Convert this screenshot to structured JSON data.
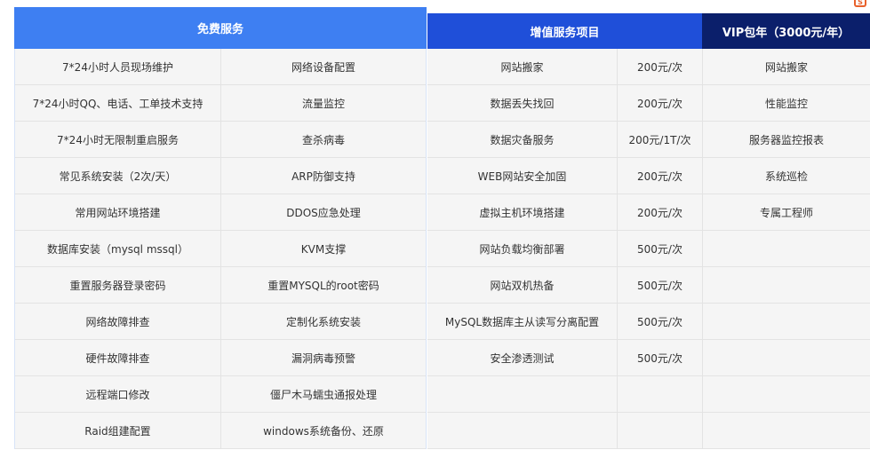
{
  "corner_icon": "logo-badge-icon",
  "colors": {
    "free_header": "#3e7ff2",
    "paid_header": "#1f4fd9",
    "vip_header": "#0b1f6b",
    "cell_bg": "#f5f5f5"
  },
  "free": {
    "title": "免费服务",
    "rows": [
      [
        "7*24小时人员现场维护",
        "网络设备配置"
      ],
      [
        "7*24小时QQ、电话、工单技术支持",
        "流量监控"
      ],
      [
        "7*24小时无限制重启服务",
        "查杀病毒"
      ],
      [
        "常见系统安装（2次/天）",
        "ARP防御支持"
      ],
      [
        "常用网站环境搭建",
        "DDOS应急处理"
      ],
      [
        "数据库安装（mysql mssql）",
        "KVM支撑"
      ],
      [
        "重置服务器登录密码",
        "重置MYSQL的root密码"
      ],
      [
        "网络故障排查",
        "定制化系统安装"
      ],
      [
        "硬件故障排查",
        "漏洞病毒预警"
      ],
      [
        "远程端口修改",
        "僵尸木马蠕虫通报处理"
      ],
      [
        "Raid组建配置",
        "windows系统备份、还原"
      ]
    ]
  },
  "paid": {
    "title": "增值服务项目",
    "rows": [
      [
        "网站搬家",
        "200元/次"
      ],
      [
        "数据丢失找回",
        "200元/次"
      ],
      [
        "数据灾备服务",
        "200元/1T/次"
      ],
      [
        "WEB网站安全加固",
        "200元/次"
      ],
      [
        "虚拟主机环境搭建",
        "200元/次"
      ],
      [
        "网站负载均衡部署",
        "500元/次"
      ],
      [
        "网站双机热备",
        "500元/次"
      ],
      [
        "MySQL数据库主从读写分离配置",
        "500元/次"
      ],
      [
        "安全渗透测试",
        "500元/次"
      ],
      [
        "",
        ""
      ],
      [
        "",
        ""
      ]
    ]
  },
  "vip": {
    "title": "VIP包年（3000元/年）",
    "rows": [
      "网站搬家",
      "性能监控",
      "服务器监控报表",
      "系统巡检",
      "专属工程师",
      "",
      "",
      "",
      "",
      "",
      ""
    ]
  }
}
